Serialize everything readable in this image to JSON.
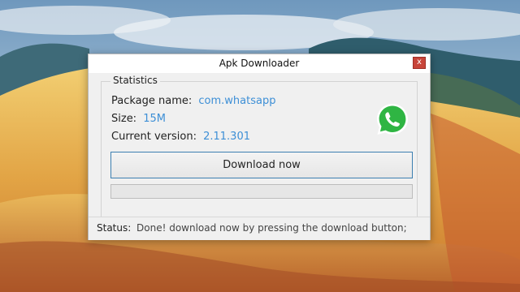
{
  "window": {
    "title": "Apk Downloader",
    "close_glyph": "x"
  },
  "statistics": {
    "legend": "Statistics",
    "package_label": "Package name:",
    "package_value": "com.whatsapp",
    "size_label": "Size:",
    "size_value": "15M",
    "version_label": "Current version:",
    "version_value": "2.11.301"
  },
  "app_icon": {
    "icon": "whatsapp-logo-icon",
    "color": "#2fb543"
  },
  "download_button": {
    "label": "Download now"
  },
  "progress": {
    "value": 0
  },
  "status": {
    "label": "Status:",
    "text": "Done! download now by pressing the download button;"
  },
  "colors": {
    "accent": "#3d8fd6",
    "close": "#c8453a"
  }
}
